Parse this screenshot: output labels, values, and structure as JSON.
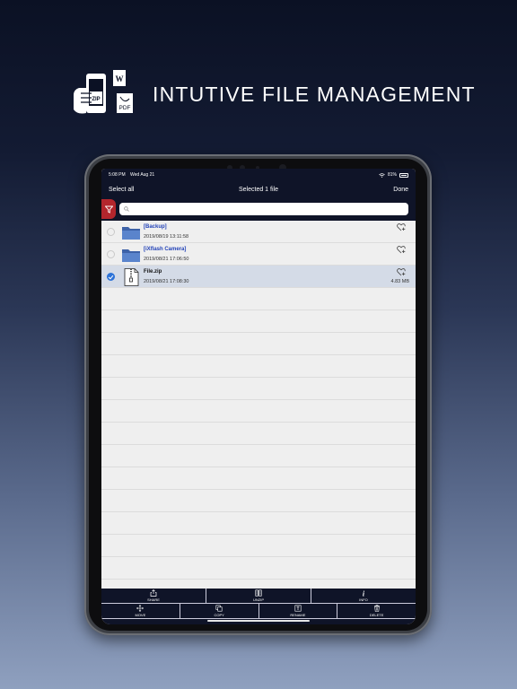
{
  "hero": {
    "title": "INTUTIVE FILE MANAGEMENT",
    "icon_labels": {
      "zip": "ZIP",
      "pdf": "PDF"
    }
  },
  "status_bar": {
    "time": "5:08 PM",
    "date": "Wed Aug 21",
    "battery": "81%"
  },
  "nav": {
    "left": "Select all",
    "title": "Selected 1 file",
    "right": "Done"
  },
  "search": {
    "placeholder": ""
  },
  "files": [
    {
      "name": "[Backup]",
      "date": "2019/08/19 13:11:58",
      "size": "",
      "type": "folder",
      "selected": false
    },
    {
      "name": "[iXflash Camera]",
      "date": "2019/08/21 17:06:50",
      "size": "",
      "type": "folder",
      "selected": false
    },
    {
      "name": "File.zip",
      "date": "2019/08/21 17:08:30",
      "size": "4.83 MB",
      "type": "zip",
      "selected": true
    }
  ],
  "toolbar": {
    "share": "SHARE",
    "unzip": "UNZIP",
    "info": "INFO",
    "move": "MOVE",
    "copy": "COPY",
    "rename": "RENAME",
    "delete": "DELETE"
  },
  "colors": {
    "bar_bg": "#0f1428",
    "filter_red": "#b3262d",
    "folder_blue": "#4d76c0",
    "link_blue": "#2242b8",
    "check_blue": "#2d73d8"
  }
}
